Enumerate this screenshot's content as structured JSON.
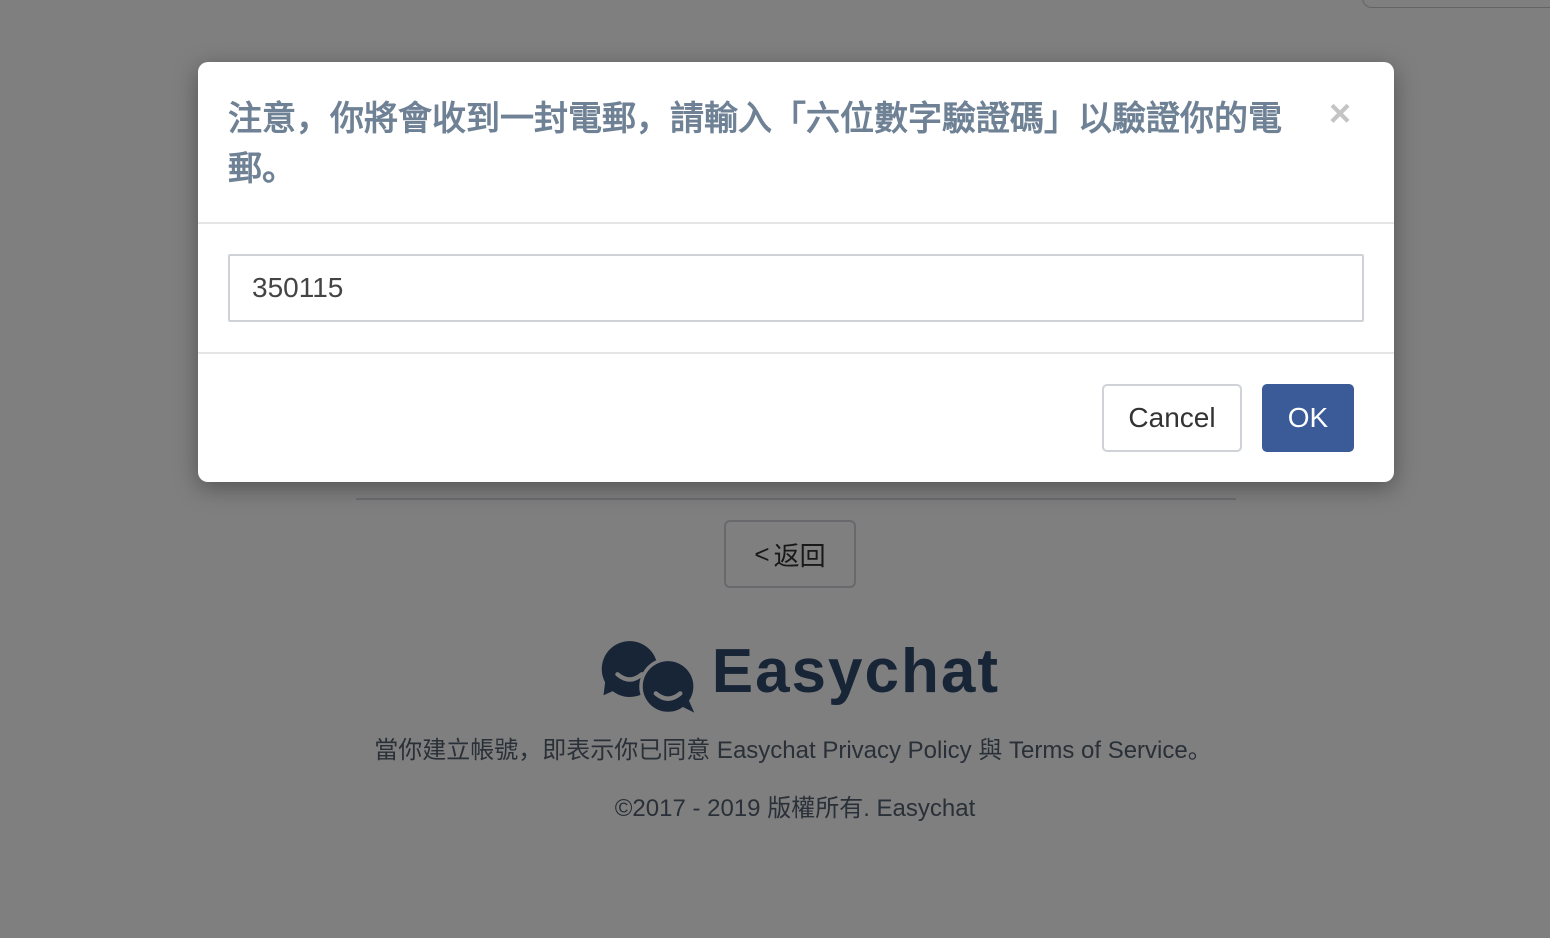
{
  "background_page": {
    "back_button": {
      "arrow": "<",
      "label": "返回"
    },
    "logo": {
      "icon": "chat-bubbles-logo-icon",
      "text": "Easychat",
      "color": "#2f4a6e"
    },
    "terms_text": "當你建立帳號，即表示你已同意 Easychat Privacy Policy 與 Terms of Service。",
    "copyright_text": "©2017 - 2019 版權所有. Easychat"
  },
  "modal": {
    "title": "注意，你將會收到一封電郵，請輸入「六位數字驗證碼」以驗證你的電郵。",
    "close_symbol": "×",
    "code_input": {
      "value": "350115",
      "placeholder": ""
    },
    "cancel_label": "Cancel",
    "ok_label": "OK",
    "ok_color": "#3a5a98",
    "title_color": "#6f8195"
  },
  "overlay": {
    "backdrop_color": "rgba(0,0,0,0.5)"
  }
}
